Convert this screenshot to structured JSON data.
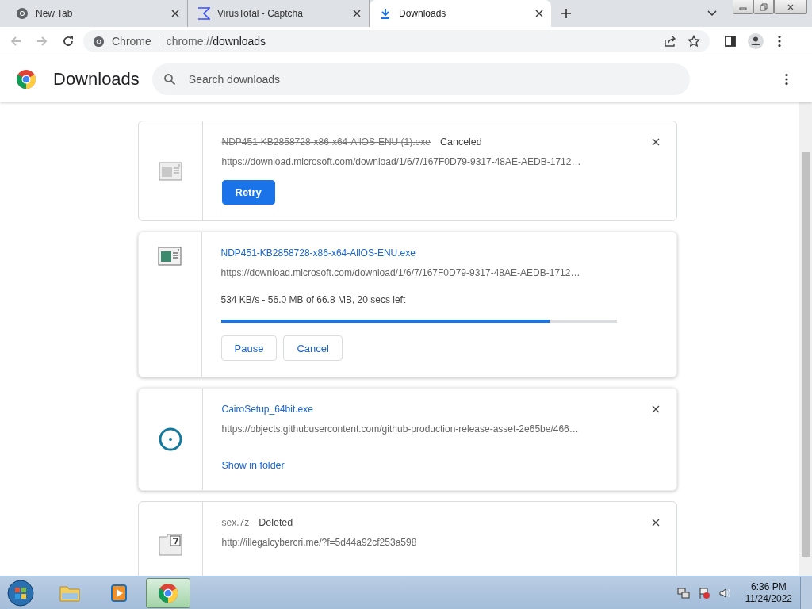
{
  "tabs": [
    {
      "title": "New Tab",
      "selected": false
    },
    {
      "title": "VirusTotal - Captcha",
      "selected": false
    },
    {
      "title": "Downloads",
      "selected": true
    }
  ],
  "omnibox": {
    "site": "Chrome",
    "url_prefix": "chrome://",
    "url_path": "downloads"
  },
  "header": {
    "title": "Downloads",
    "search_placeholder": "Search downloads"
  },
  "downloads": [
    {
      "kind": "canceled",
      "filename": "NDP451-KB2858728-x86-x64-AllOS-ENU (1).exe",
      "status": "Canceled",
      "url": "https://download.microsoft.com/download/1/6/7/167F0D79-9317-48AE-AEDB-1712…",
      "buttons": [
        "Retry"
      ]
    },
    {
      "kind": "in_progress",
      "filename": "NDP451-KB2858728-x86-x64-AllOS-ENU.exe",
      "url": "https://download.microsoft.com/download/1/6/7/167F0D79-9317-48AE-AEDB-1712…",
      "progress_text": "534 KB/s - 56.0 MB of 66.8 MB, 20 secs left",
      "level": 0.83,
      "buttons": [
        "Pause",
        "Cancel"
      ]
    },
    {
      "kind": "complete",
      "filename": "CairoSetup_64bit.exe",
      "url": "https://objects.githubusercontent.com/github-production-release-asset-2e65be/466…",
      "link": "Show in folder"
    },
    {
      "kind": "deleted",
      "filename": "sex.7z",
      "status": "Deleted",
      "url": "http://illegalcybercri.me/?f=5d44a92cf253a598"
    }
  ],
  "taskbar": {
    "apps": [
      {
        "selected": false
      },
      {
        "selected": false
      },
      {
        "selected": true
      }
    ],
    "time": "6:36 PM",
    "date": "11/24/2022"
  }
}
